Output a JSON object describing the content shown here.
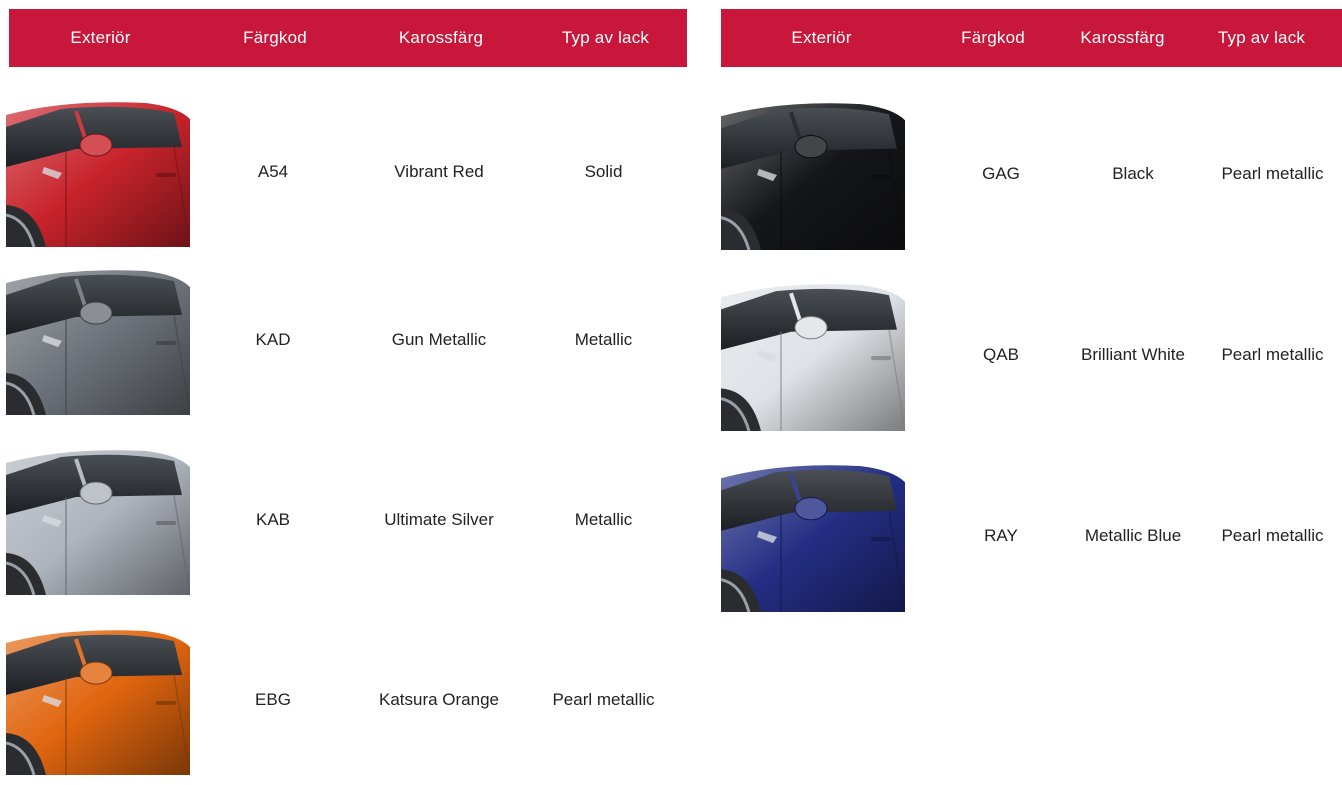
{
  "colors": {
    "header_bg": "#c8173a"
  },
  "left_table": {
    "headers": [
      "Exteriör",
      "Färgkod",
      "Karossfärg",
      "Typ av lack"
    ],
    "rows": [
      {
        "code": "A54",
        "name": "Vibrant Red",
        "paint": "Solid",
        "swatch_color": "#c8232b"
      },
      {
        "code": "KAD",
        "name": "Gun Metallic",
        "paint": "Metallic",
        "swatch_color": "#6e737b"
      },
      {
        "code": "KAB",
        "name": "Ultimate Silver",
        "paint": "Metallic",
        "swatch_color": "#aeb4bd"
      },
      {
        "code": "EBG",
        "name": "Katsura Orange",
        "paint": "Pearl metallic",
        "swatch_color": "#e0650f"
      }
    ]
  },
  "right_table": {
    "headers": [
      "Exteriör",
      "Färgkod",
      "Karossfärg",
      "Typ av lack"
    ],
    "rows": [
      {
        "code": "GAG",
        "name": "Black",
        "paint": "Pearl metallic",
        "swatch_color": "#15161a"
      },
      {
        "code": "QAB",
        "name": "Brilliant White",
        "paint": "Pearl metallic",
        "swatch_color": "#dfe2e6"
      },
      {
        "code": "RAY",
        "name": "Metallic Blue",
        "paint": "Pearl metallic",
        "swatch_color": "#232e84"
      }
    ]
  }
}
